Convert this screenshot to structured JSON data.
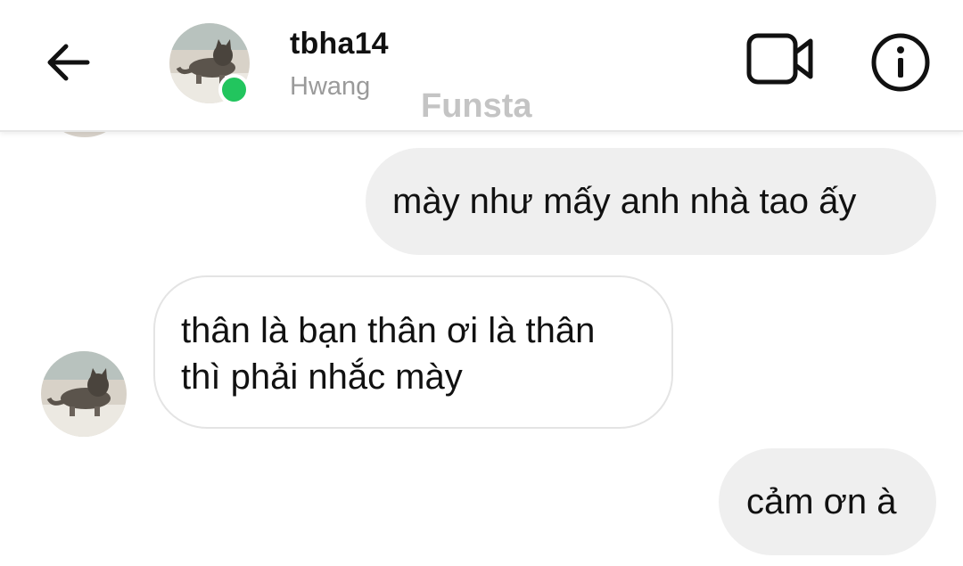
{
  "header": {
    "back_icon": "arrow-left-icon",
    "username": "tbha14",
    "display_name": "Hwang",
    "account_tag": "Funsta",
    "online_status": "online",
    "online_color": "#22c55e",
    "video_call_icon": "video-camera-icon",
    "info_icon": "info-icon"
  },
  "thread": {
    "messages": [
      {
        "direction": "sent",
        "text": "mày như mấy anh nhà tao ấy"
      },
      {
        "direction": "received",
        "text_lines": [
          "thân là bạn thân ơi là thân",
          "thì phải nhắc mày"
        ]
      },
      {
        "direction": "sent",
        "text": "cảm ơn à"
      }
    ]
  },
  "colors": {
    "sent_bubble": "#efefef",
    "received_bubble_border": "#e4e4e4",
    "text": "#111111",
    "secondary_text": "#9a9a9a"
  }
}
